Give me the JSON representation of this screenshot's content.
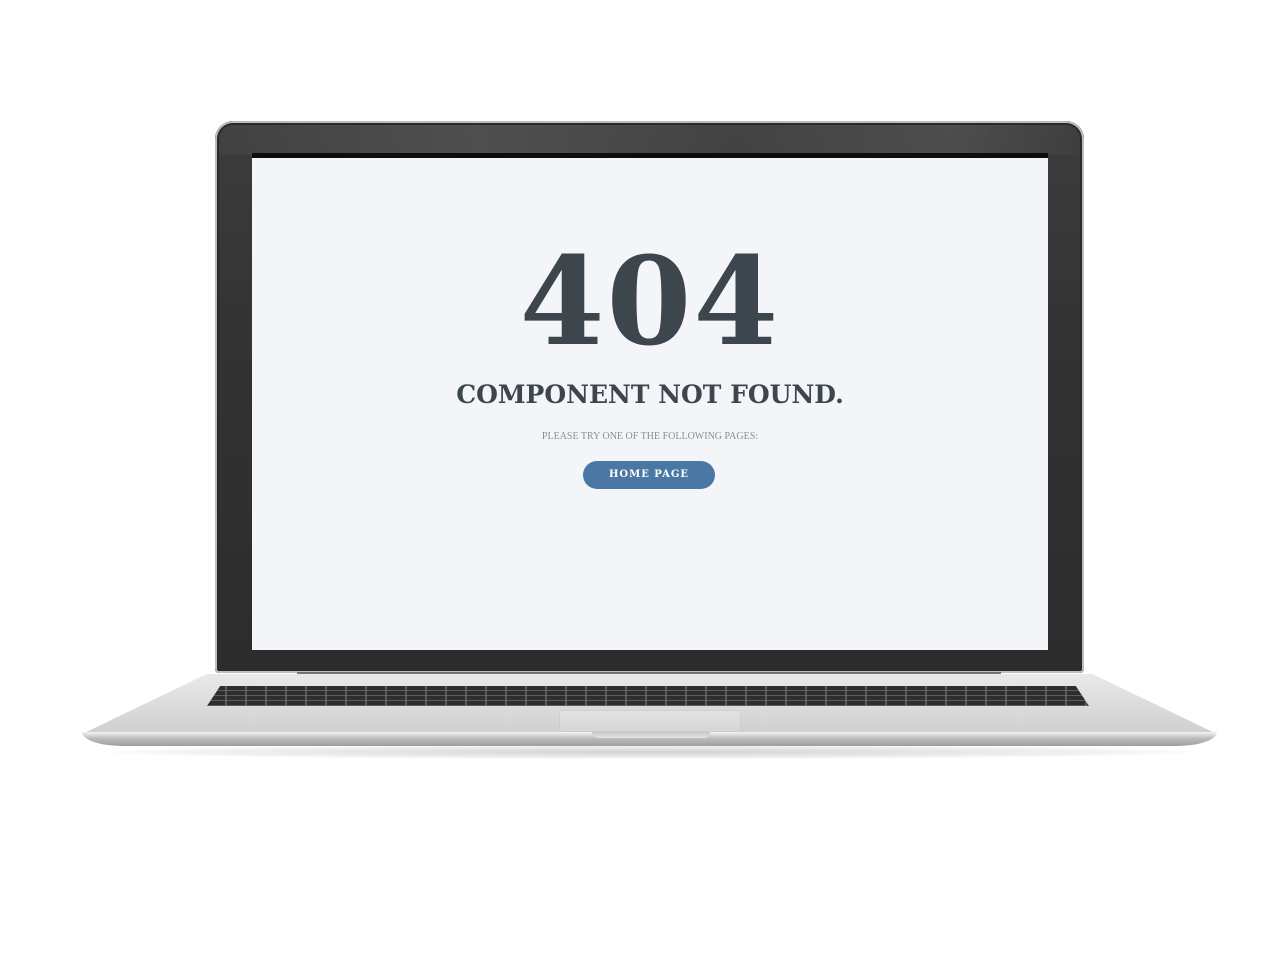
{
  "error_page": {
    "code": "404",
    "title": "COMPONENT NOT FOUND.",
    "subtitle": "PLEASE TRY ONE OF THE FOLLOWING PAGES:",
    "home_button_label": "HOME PAGE"
  },
  "colors": {
    "screen_background": "#f3f5f9",
    "heading_text": "#3d454d",
    "subtitle_text": "#888e94",
    "button_background": "#4a77a4",
    "button_text": "#ffffff",
    "laptop_bezel": "#333333",
    "laptop_body": "#dadada"
  }
}
